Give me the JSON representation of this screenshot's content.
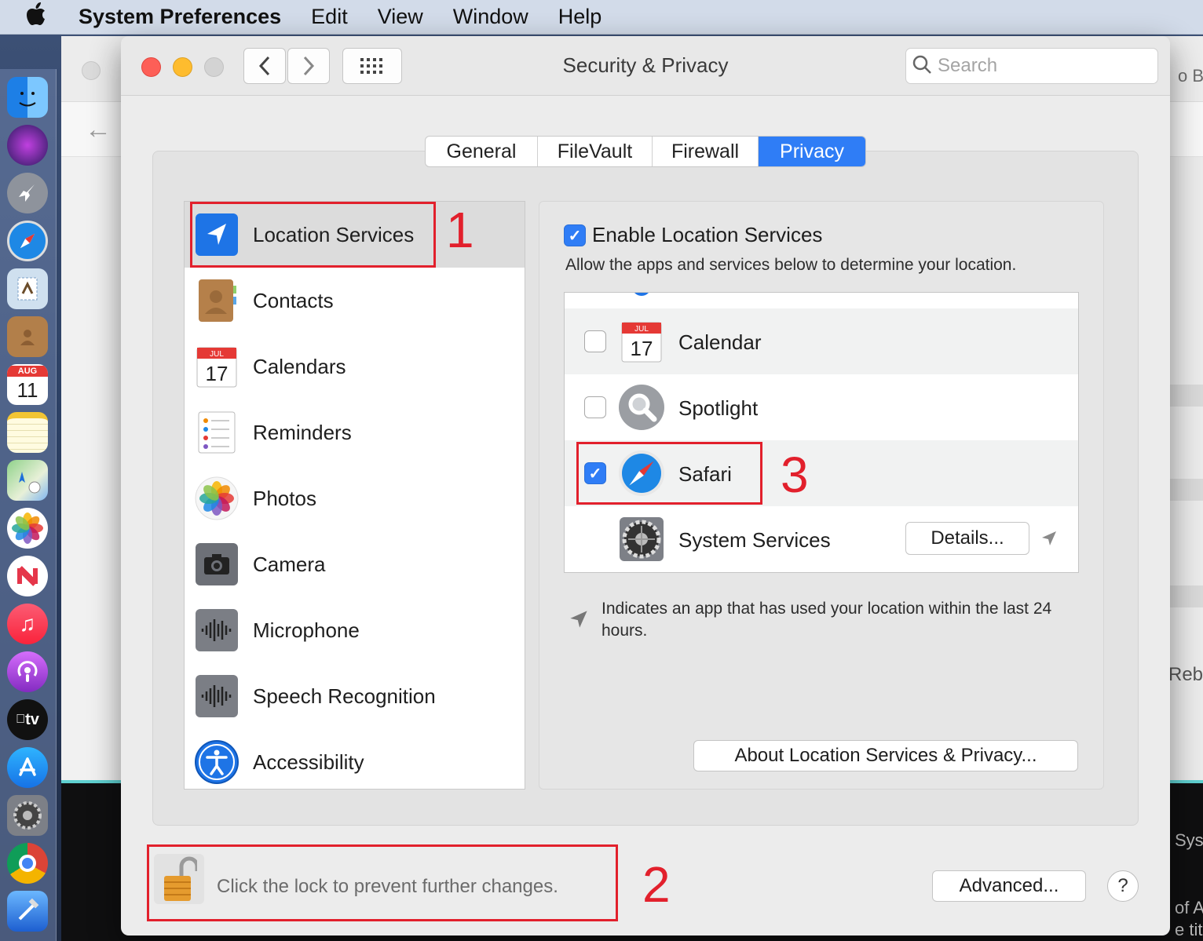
{
  "menubar": {
    "app_name": "System Preferences",
    "items": [
      "Edit",
      "View",
      "Window",
      "Help"
    ]
  },
  "background_window": {
    "partial_texts": [
      "o Bu",
      "Rebu",
      "Sys",
      "of A",
      "e title"
    ]
  },
  "dock": {
    "calendar_month": "AUG",
    "calendar_day": "11",
    "tv_label": "tv"
  },
  "window": {
    "title": "Security & Privacy",
    "search_placeholder": "Search"
  },
  "tabs": [
    {
      "label": "General",
      "active": false
    },
    {
      "label": "FileVault",
      "active": false
    },
    {
      "label": "Firewall",
      "active": false
    },
    {
      "label": "Privacy",
      "active": true
    }
  ],
  "categories": [
    {
      "label": "Location Services",
      "icon": "location-arrow-icon",
      "selected": true
    },
    {
      "label": "Contacts",
      "icon": "contacts-book-icon"
    },
    {
      "label": "Calendars",
      "icon": "calendar-icon"
    },
    {
      "label": "Reminders",
      "icon": "reminders-icon"
    },
    {
      "label": "Photos",
      "icon": "photos-flower-icon"
    },
    {
      "label": "Camera",
      "icon": "camera-icon"
    },
    {
      "label": "Microphone",
      "icon": "microphone-waveform-icon"
    },
    {
      "label": "Speech Recognition",
      "icon": "speech-waveform-icon"
    },
    {
      "label": "Accessibility",
      "icon": "accessibility-icon"
    }
  ],
  "calendar_icon": {
    "month": "JUL",
    "day": "17"
  },
  "location": {
    "enable_label": "Enable Location Services",
    "enable_checked": true,
    "description": "Allow the apps and services below to determine your location.",
    "apps": [
      {
        "name": "Calendar",
        "checked": false,
        "icon": "calendar-icon"
      },
      {
        "name": "Spotlight",
        "checked": false,
        "icon": "spotlight-magnifier-icon"
      },
      {
        "name": "Safari",
        "checked": true,
        "icon": "safari-compass-icon"
      },
      {
        "name": "System Services",
        "icon": "system-preferences-gear-icon"
      }
    ],
    "details_button": "Details...",
    "indicator_note": "Indicates an app that has used your location within the last 24 hours.",
    "about_button": "About Location Services & Privacy..."
  },
  "footer": {
    "lock_text": "Click the lock to prevent further changes.",
    "advanced_button": "Advanced...",
    "help_button": "?"
  },
  "annotations": [
    "1",
    "2",
    "3"
  ],
  "colors": {
    "accent_blue": "#2f7df6",
    "annotation_red": "#e2202c"
  }
}
